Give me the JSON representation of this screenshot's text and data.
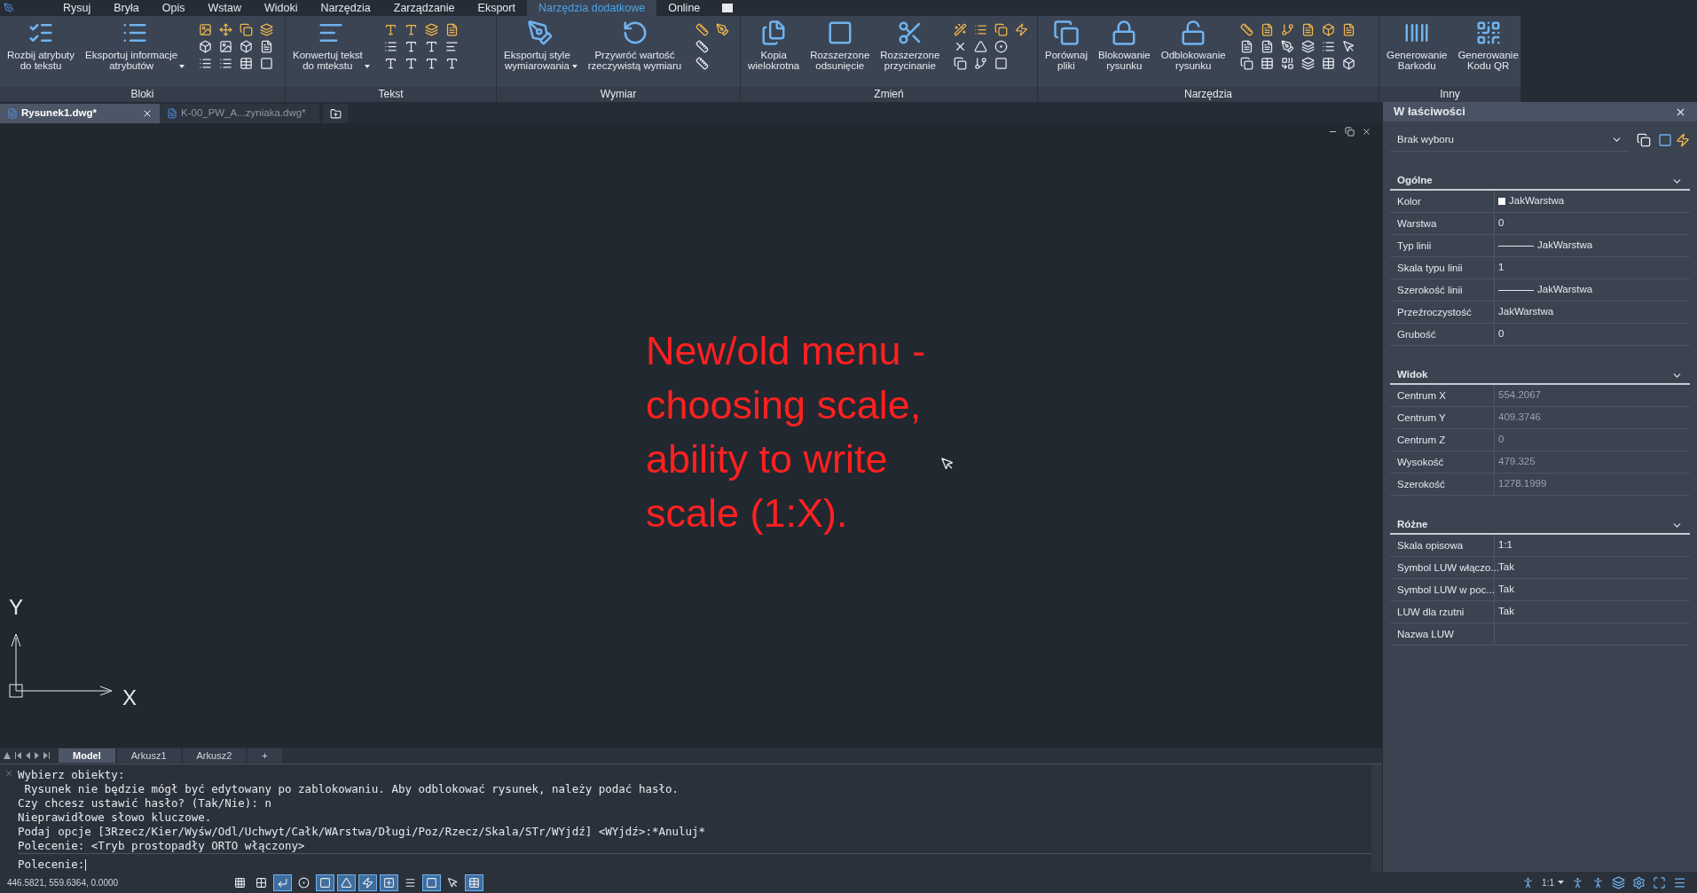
{
  "menu_tabs": [
    {
      "label": "Rysuj",
      "selected": false
    },
    {
      "label": "Bryła",
      "selected": false
    },
    {
      "label": "Opis",
      "selected": false
    },
    {
      "label": "Wstaw",
      "selected": false
    },
    {
      "label": "Widoki",
      "selected": false
    },
    {
      "label": "Narzędzia",
      "selected": false
    },
    {
      "label": "Zarządzanie",
      "selected": false
    },
    {
      "label": "Eksport",
      "selected": false
    },
    {
      "label": "Narzędzia dodatkowe",
      "selected": true
    },
    {
      "label": "Online",
      "selected": false
    }
  ],
  "ribbon_groups": [
    {
      "title": "Bloki",
      "buttons": [
        {
          "label": "Rozbij atrybuty\ndo tekstu",
          "dropdown": false
        },
        {
          "label": "Eksportuj informacje\natrybutów",
          "dropdown": true
        }
      ]
    },
    {
      "title": "Tekst",
      "buttons": [
        {
          "label": "Konwertuj tekst\ndo mtekstu",
          "dropdown": true
        }
      ]
    },
    {
      "title": "Wymiar",
      "buttons": [
        {
          "label": "Eksportuj style\nwymiarowania",
          "dropdown": true
        },
        {
          "label": "Przywróć wartość\nrzeczywistą wymiaru",
          "dropdown": false
        }
      ]
    },
    {
      "title": "Zmień",
      "buttons": [
        {
          "label": "Kopia\nwielokrotna",
          "dropdown": false
        },
        {
          "label": "Rozszerzone\nodsunięcie",
          "dropdown": false
        },
        {
          "label": "Rozszerzone\nprzycinanie",
          "dropdown": false
        }
      ]
    },
    {
      "title": "Narzędzia",
      "buttons": [
        {
          "label": "Porównaj\npliki",
          "dropdown": false
        },
        {
          "label": "Blokowanie\nrysunku",
          "dropdown": false
        },
        {
          "label": "Odblokowanie\nrysunku",
          "dropdown": false
        }
      ]
    },
    {
      "title": "Inny",
      "buttons": [
        {
          "label": "Generowanie\nBarkodu",
          "dropdown": false
        },
        {
          "label": "Generowanie\nKodu QR",
          "dropdown": false
        }
      ]
    }
  ],
  "document_tabs": [
    {
      "label": "Rysunek1.dwg*",
      "selected": true
    },
    {
      "label": "K-00_PW_A...zyniaka.dwg*",
      "selected": false
    }
  ],
  "canvas": {
    "annotation": "New/old menu -\nchoosing scale,\nability to write\nscale (1:X).",
    "axis_y": "Y",
    "axis_x": "X"
  },
  "layout_tabs": [
    {
      "label": "Model",
      "selected": true
    },
    {
      "label": "Arkusz1",
      "selected": false
    },
    {
      "label": "Arkusz2",
      "selected": false
    },
    {
      "label": "+",
      "selected": false
    }
  ],
  "command_history": [
    "Wybierz obiekty:",
    " Rysunek nie będzie mógł być edytowany po zablokowaniu. Aby odblokować rysunek, należy podać hasło.",
    "Czy chcesz ustawić hasło? (Tak/Nie): n",
    "Nieprawidłowe słowo kluczowe.",
    "Podaj opcje [3Rzecz/Kier/Wyśw/Odl/Uchwyt/Całk/WArstwa/Długi/Poz/Rzecz/Skala/STr/WYjdź] <WYjdź>:*Anuluj*",
    "Polecenie: <Tryb prostopadły ORTO włączony>"
  ],
  "command_prompt": "Polecenie:",
  "status_bar": {
    "coordinates": "446.5821, 559.6364, 0.0000",
    "toggles": [
      {
        "on": false
      },
      {
        "on": false
      },
      {
        "on": true
      },
      {
        "on": false
      },
      {
        "on": true
      },
      {
        "on": true
      },
      {
        "on": true
      },
      {
        "on": true
      },
      {
        "on": false
      },
      {
        "on": true
      },
      {
        "on": false
      },
      {
        "on": true
      }
    ],
    "annotation_scale": "1:1"
  },
  "properties": {
    "title": "W łaściwości",
    "selection": "Brak wyboru",
    "sections": [
      {
        "title": "Ogólne",
        "expanded": true,
        "rows": [
          {
            "label": "Kolor",
            "value": "JakWarstwa",
            "kind": "swatch",
            "readonly": false
          },
          {
            "label": "Warstwa",
            "value": "0",
            "kind": "text",
            "readonly": false
          },
          {
            "label": "Typ linii",
            "value": "JakWarstwa",
            "kind": "line",
            "readonly": false
          },
          {
            "label": "Skala typu linii",
            "value": "1",
            "kind": "text",
            "readonly": false
          },
          {
            "label": "Szerokość linii",
            "value": "JakWarstwa",
            "kind": "line",
            "readonly": false
          },
          {
            "label": "Przeźroczystość",
            "value": "JakWarstwa",
            "kind": "text",
            "readonly": false
          },
          {
            "label": "Grubość",
            "value": "0",
            "kind": "text",
            "readonly": false
          }
        ]
      },
      {
        "title": "Widok",
        "expanded": true,
        "rows": [
          {
            "label": "Centrum X",
            "value": "554.2067",
            "kind": "text",
            "readonly": true
          },
          {
            "label": "Centrum Y",
            "value": "409.3746",
            "kind": "text",
            "readonly": true
          },
          {
            "label": "Centrum Z",
            "value": "0",
            "kind": "text",
            "readonly": true
          },
          {
            "label": "Wysokość",
            "value": "479.325",
            "kind": "text",
            "readonly": true
          },
          {
            "label": "Szerokość",
            "value": "1278.1999",
            "kind": "text",
            "readonly": true
          }
        ]
      },
      {
        "title": "Różne",
        "expanded": true,
        "rows": [
          {
            "label": "Skala opisowa",
            "value": "1:1",
            "kind": "text",
            "readonly": false
          },
          {
            "label": "Symbol LUW włączo...",
            "value": "Tak",
            "kind": "text",
            "readonly": false
          },
          {
            "label": "Symbol LUW w poc...",
            "value": "Tak",
            "kind": "text",
            "readonly": false
          },
          {
            "label": "LUW dla rzutni",
            "value": "Tak",
            "kind": "text",
            "readonly": false
          },
          {
            "label": "Nazwa LUW",
            "kind": "text",
            "readonly": false
          }
        ]
      }
    ]
  }
}
